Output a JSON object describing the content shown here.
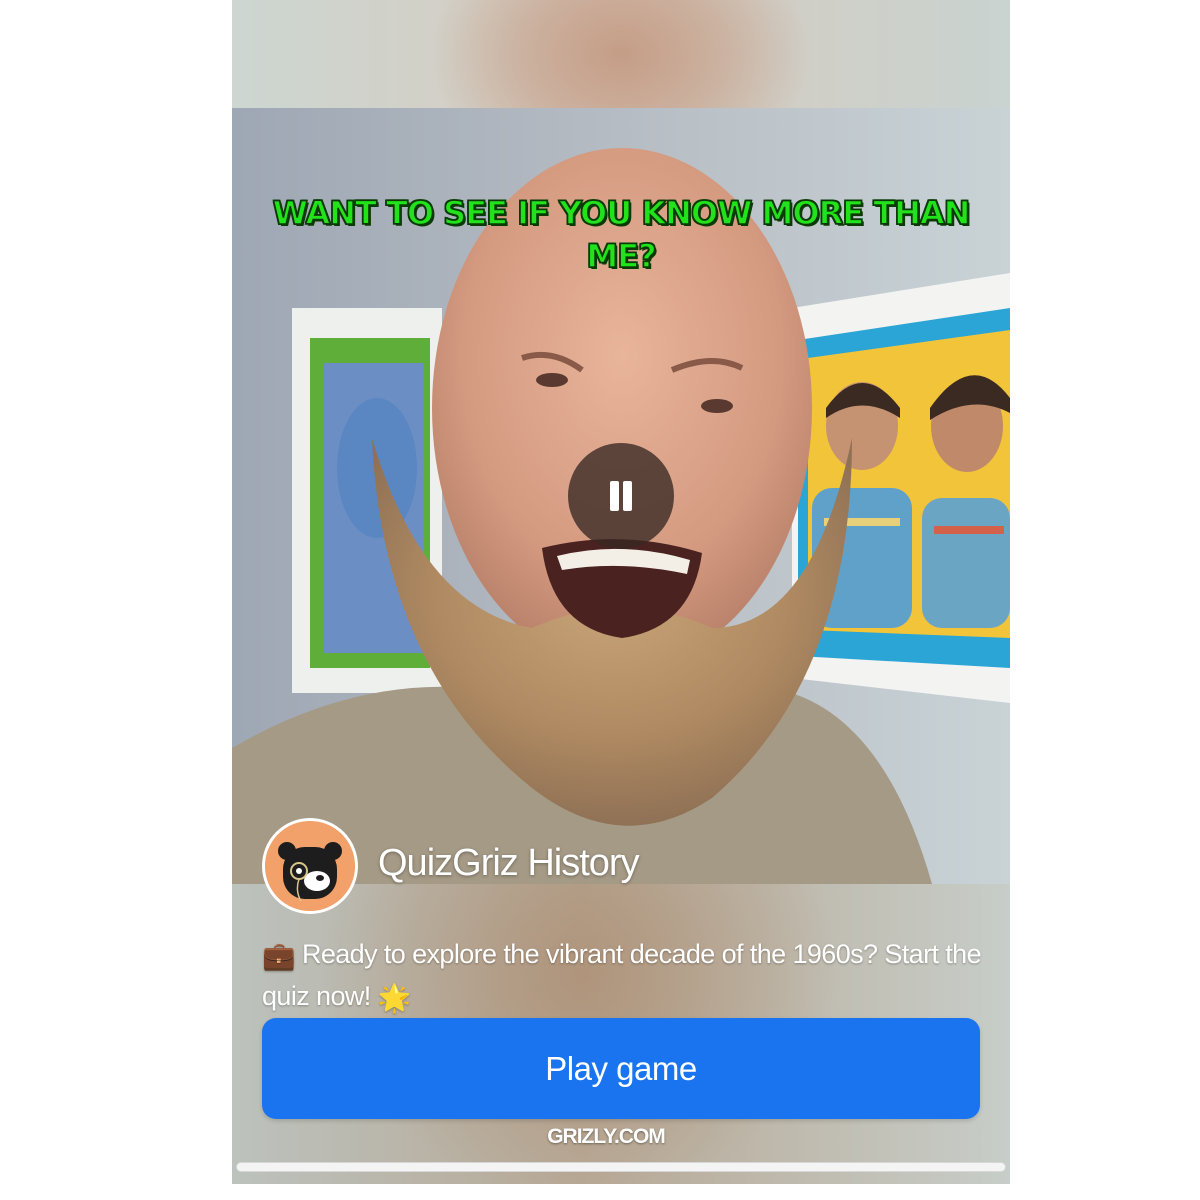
{
  "video": {
    "caption": "WANT TO SEE IF YOU KNOW MORE THAN ME?",
    "control_icon": "pause-icon",
    "progress": 0.0
  },
  "advertiser": {
    "name": "QuizGriz History",
    "avatar_icon": "bear-monocle-icon"
  },
  "description": {
    "emoji_start": "💼",
    "text": "Ready to explore the vibrant decade of the 1960s? Start the quiz now!",
    "emoji_end": "🌟"
  },
  "cta": {
    "label": "Play game",
    "color": "#1a74f0"
  },
  "domain": "GRIZLY.COM"
}
